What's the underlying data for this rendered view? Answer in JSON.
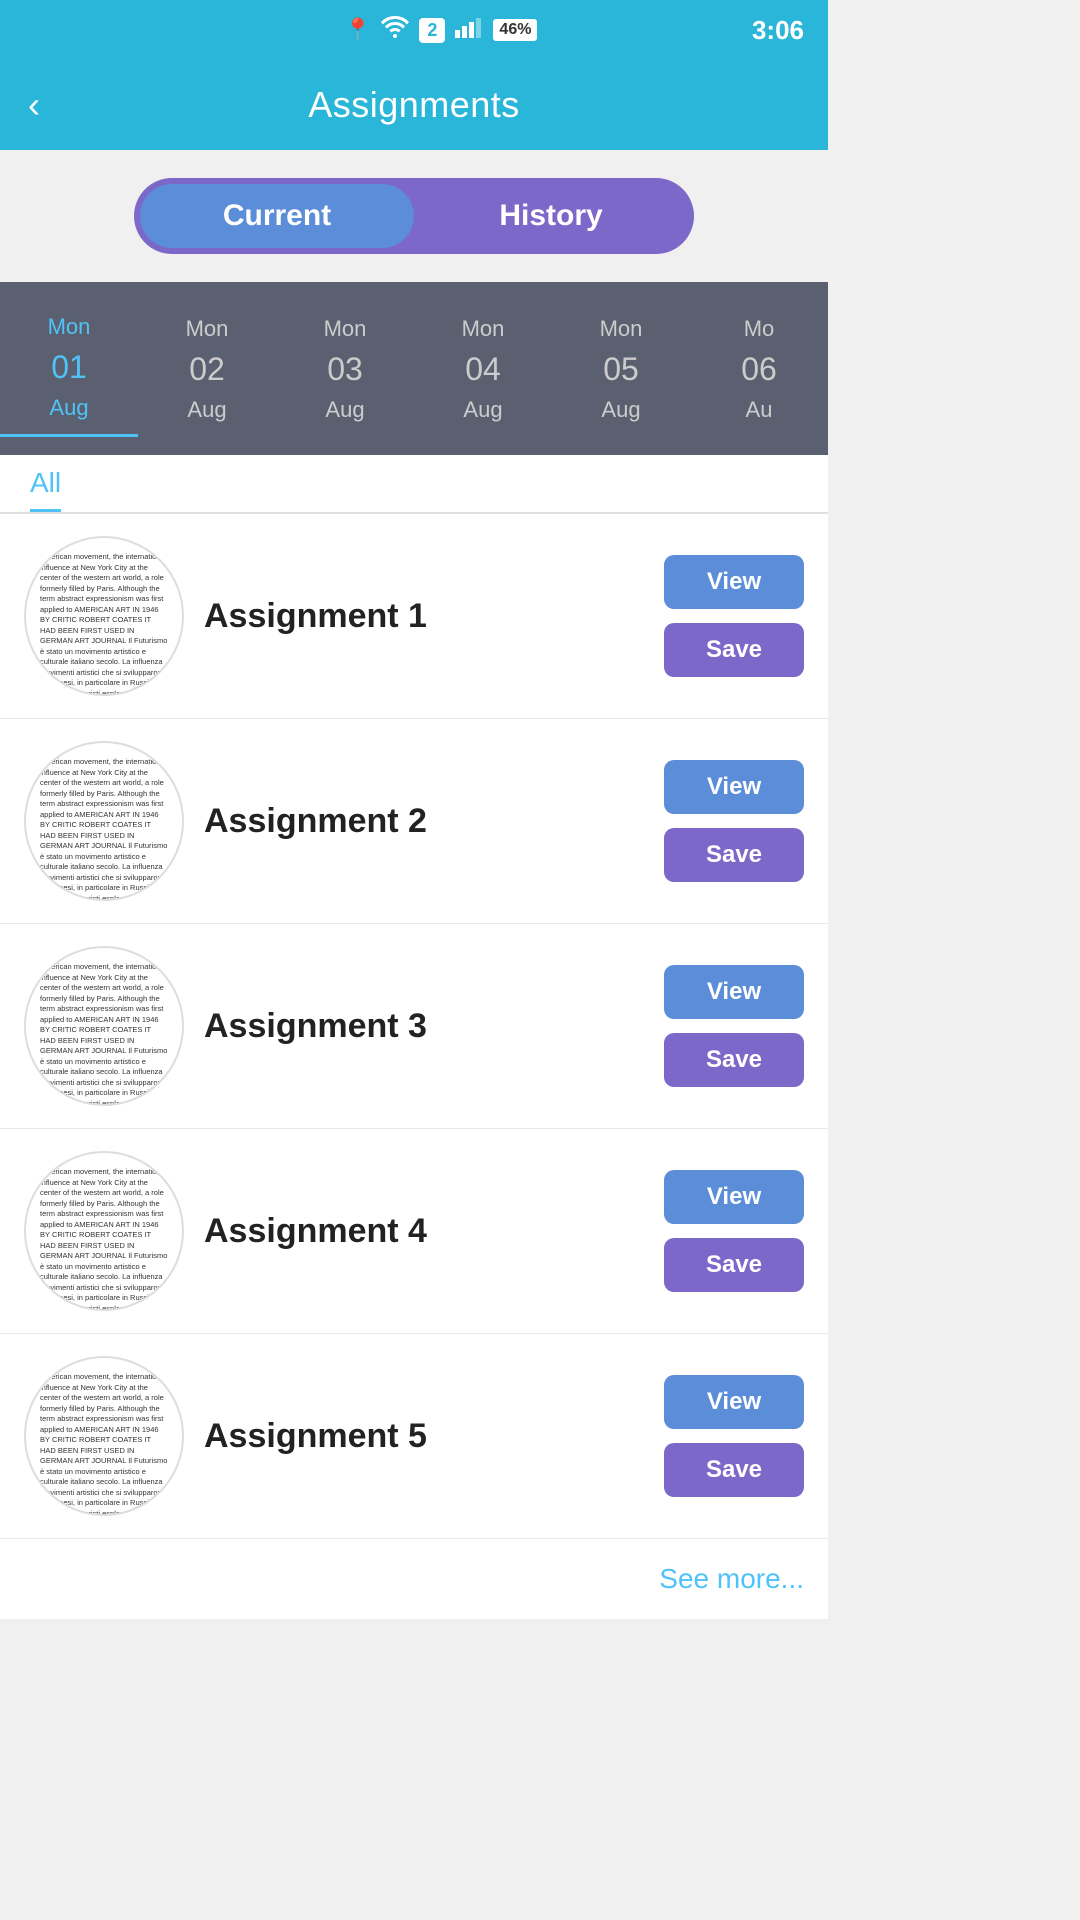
{
  "statusBar": {
    "notif_count": "2",
    "battery": "46%",
    "time": "3:06"
  },
  "nav": {
    "back_label": "‹",
    "title": "Assignments"
  },
  "toggle": {
    "current_label": "Current",
    "history_label": "History"
  },
  "dates": [
    {
      "day": "Mon",
      "num": "01",
      "month": "Aug",
      "active": true
    },
    {
      "day": "Mon",
      "num": "02",
      "month": "Aug",
      "active": false
    },
    {
      "day": "Mon",
      "num": "03",
      "month": "Aug",
      "active": false
    },
    {
      "day": "Mon",
      "num": "04",
      "month": "Aug",
      "active": false
    },
    {
      "day": "Mon",
      "num": "05",
      "month": "Aug",
      "active": false
    },
    {
      "day": "Mo",
      "num": "06",
      "month": "Au",
      "active": false
    }
  ],
  "filter": {
    "label": "All"
  },
  "assignments": [
    {
      "id": 1,
      "title": "Assignment 1",
      "view_label": "View",
      "save_label": "Save"
    },
    {
      "id": 2,
      "title": "Assignment 2",
      "view_label": "View",
      "save_label": "Save"
    },
    {
      "id": 3,
      "title": "Assignment 3",
      "view_label": "View",
      "save_label": "Save"
    },
    {
      "id": 4,
      "title": "Assignment 4",
      "view_label": "View",
      "save_label": "Save"
    },
    {
      "id": 5,
      "title": "Assignment 5",
      "view_label": "View",
      "save_label": "Save"
    }
  ],
  "thumbText": "American movement, the international influence at New York City at the center of the western art world, a role formerly filled by Paris. Although the term abstract expressionism was first applied to AMERICAN ART IN 1946 BY CRITIC ROBERT COATES IT HAD BEEN FIRST USED IN GERMAN ART JOURNAL\n\nIl Futurismo è stato un movimento artistico e culturale italiano secolo. La influenza movimenti artistici che si svilupparono altri Paesi, in particolare in Russia e Francia. I Futuristi esplorarono la forma di espressione, dalla pittura della, alla letteratura, la musica, architettura, il cinema e persi...",
  "seeMore": {
    "label": "See more..."
  }
}
